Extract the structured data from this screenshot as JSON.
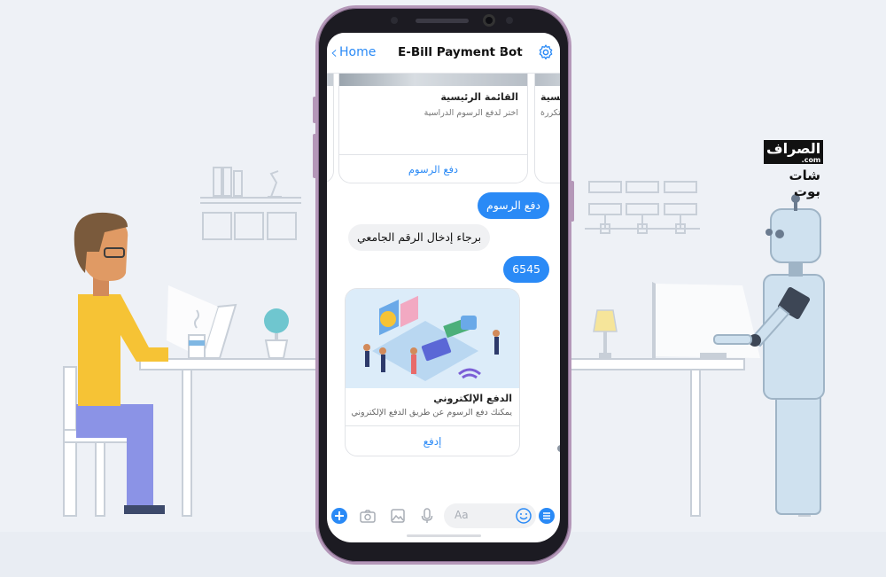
{
  "logo": {
    "brand": "الصراف",
    "domain": ".com",
    "sub": "شات بوت"
  },
  "header": {
    "back_label": "Home",
    "title": "E-Bill Payment Bot"
  },
  "carousel": {
    "card_main": {
      "title": "القائمة الرئيسية",
      "subtitle": "اختر لدفع الرسوم الدراسية",
      "button": "دفع الرسوم"
    },
    "card_next": {
      "title": "رئيسية",
      "subtitle": "متكررة"
    }
  },
  "messages": [
    {
      "from": "user",
      "text": "دفع الرسوم"
    },
    {
      "from": "bot",
      "text": "برجاء إدخال الرقم الجامعي"
    },
    {
      "from": "user",
      "text": "6545"
    }
  ],
  "payment_card": {
    "title": "الدفع الإلكتروني",
    "subtitle": "يمكنك دفع الرسوم عن طريق الدفع الإلكتروني",
    "button": "إدفع"
  },
  "composer": {
    "placeholder": "Aa"
  },
  "colors": {
    "accent": "#2a8af6",
    "phone_frame": "#b497b8",
    "background": "#eef1f6"
  }
}
